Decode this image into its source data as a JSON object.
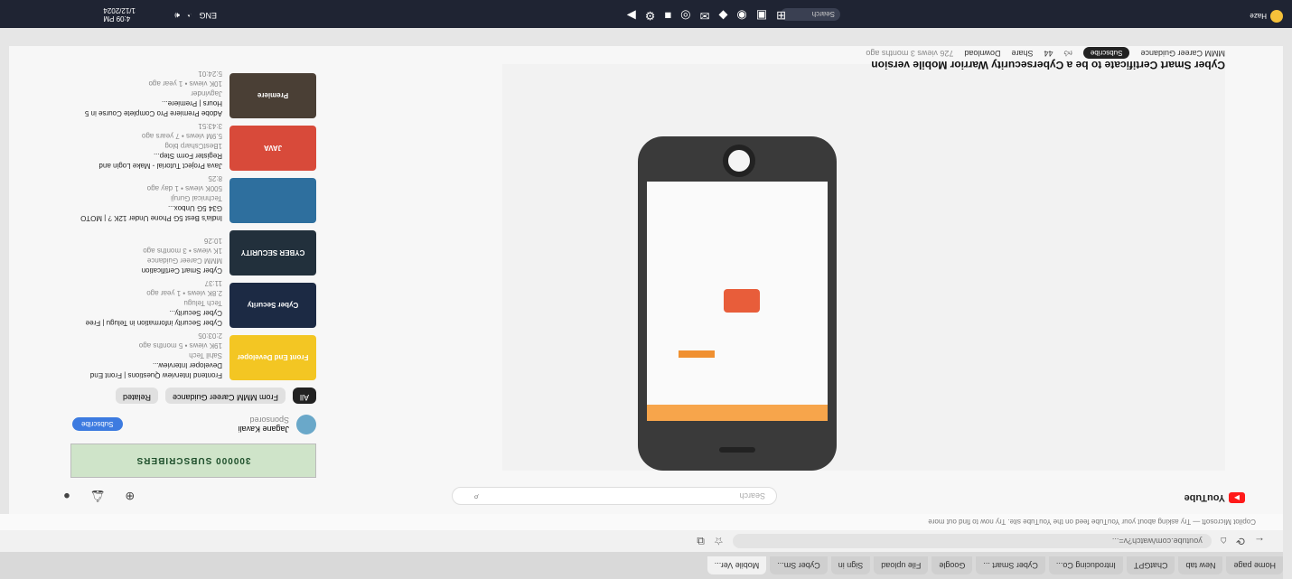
{
  "browser": {
    "tabs": [
      "Home page",
      "New tab",
      "ChatGPT",
      "Introducing Co...",
      "Cyber Smart ...",
      "Google",
      "File upload",
      "Sign in",
      "Cyber Sm...",
      "Mobile Ver..."
    ],
    "url": "youtube.com/watch?v=...",
    "infobar": "Copilot Microsoft — Try asking about your YouTube feed on the YouTube site. Try now to find out more"
  },
  "youtube": {
    "logo": "YouTube",
    "search_placeholder": "Search",
    "video_title": "Cyber Smart Certificate to be a Cybersecurity Warrior Mobile version",
    "channel_name": "MMM Career Guidance",
    "subscribe_label": "Subscribe",
    "likes": "44",
    "share_label": "Share",
    "download_label": "Download",
    "views": "726 views  3 months ago"
  },
  "sidebar": {
    "ad_banner": "300000 SUBSCRIBERS",
    "sponsor_name": "Jagane Kavali",
    "sponsor_tag": "Sponsored",
    "sponsor_button": "Subscribe",
    "chips": [
      "All",
      "From MMM Career Guidance",
      "Related"
    ],
    "related": [
      {
        "title": "Frontend Interview Questions | Front End Developer Interview...",
        "channel": "Sahil Tech",
        "meta": "19K views • 5 months ago",
        "thumb": "Front End Developer",
        "duration": "2:03:05"
      },
      {
        "title": "Cyber Security information in Telugu | Free Cyber Security...",
        "channel": "Tech Telugu",
        "meta": "2.8K views • 1 year ago",
        "thumb": "Cyber Security",
        "duration": "11:37"
      },
      {
        "title": "Cyber Smart Certification",
        "channel": "MMM Career Guidance",
        "meta": "1K views • 3 months ago",
        "thumb": "CYBER SECURITY",
        "duration": "10:26"
      },
      {
        "title": "India's Best 5G Phone Under 12K ? | MOTO G34 5G Unbox...",
        "channel": "Technical Guruji",
        "meta": "500K views • 1 day ago",
        "thumb": "",
        "duration": "8:25"
      },
      {
        "title": "Java Project Tutorial - Make Login and Register Form Step...",
        "channel": "1BestCsharp blog",
        "meta": "5.9M views • 7 years ago",
        "thumb": "JAVA",
        "duration": "3:43:51"
      },
      {
        "title": "Adobe Premiere Pro Complete Course in 5 Hours | Premiere...",
        "channel": "Jagvinder",
        "meta": "10K views • 1 year ago",
        "thumb": "Premiere",
        "duration": "5:24:01"
      }
    ]
  },
  "taskbar": {
    "search": "Search",
    "time": "4:09 PM",
    "date": "1/12/2024",
    "lang": "ENG",
    "weather": "Haze"
  }
}
